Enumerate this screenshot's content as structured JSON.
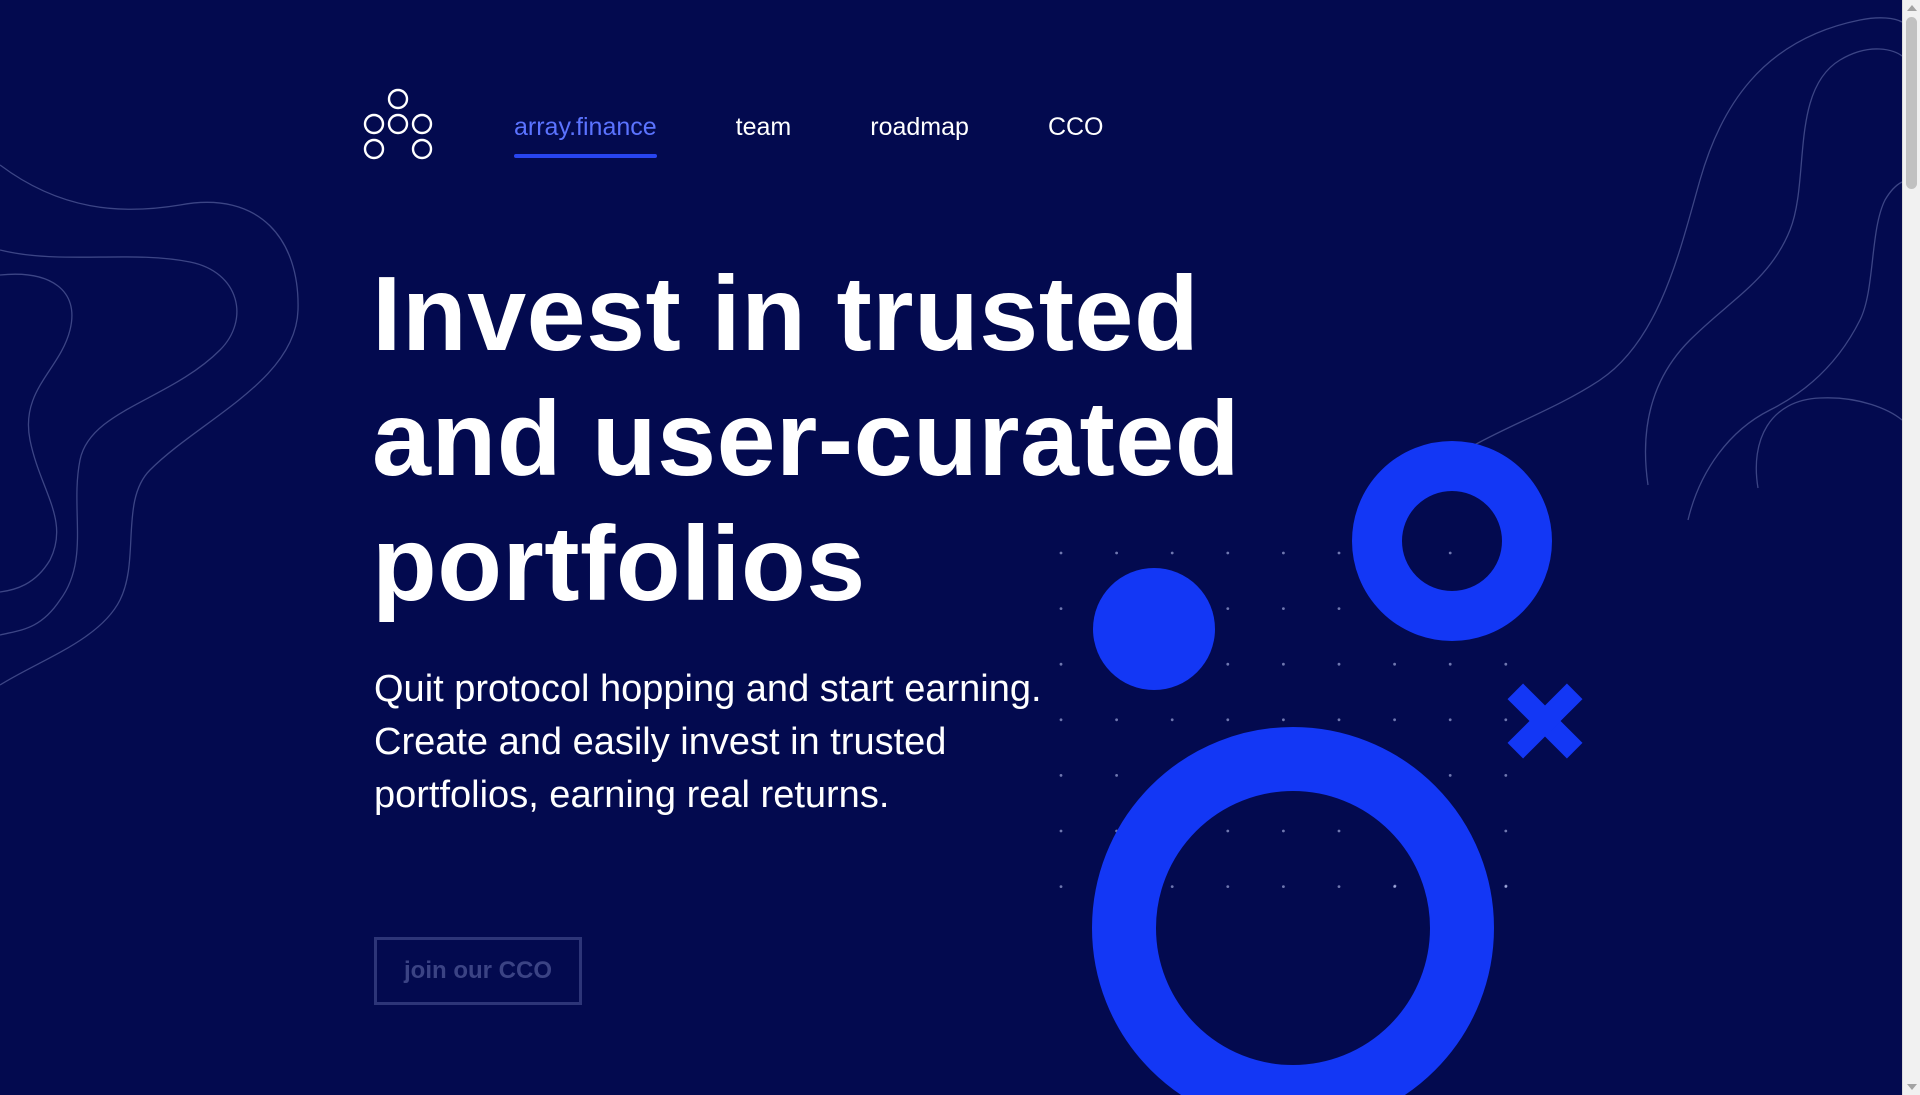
{
  "nav": {
    "logo_icon": "hex-dots-logo-icon",
    "items": [
      {
        "label": "array.finance",
        "active": true
      },
      {
        "label": "team",
        "active": false
      },
      {
        "label": "roadmap",
        "active": false
      },
      {
        "label": "CCO",
        "active": false
      }
    ]
  },
  "hero": {
    "title_lines": [
      "Invest in trusted",
      "and user-curated",
      "portfolios"
    ],
    "subtitle_lines": [
      "Quit protocol hopping and start earning.",
      "Create and easily invest in trusted",
      "portfolios, earning real returns."
    ],
    "cta_label": "join our CCO"
  },
  "colors": {
    "background": "#030a4f",
    "accent": "#1337f5",
    "active_link": "#5b73ff",
    "text": "#ffffff"
  }
}
